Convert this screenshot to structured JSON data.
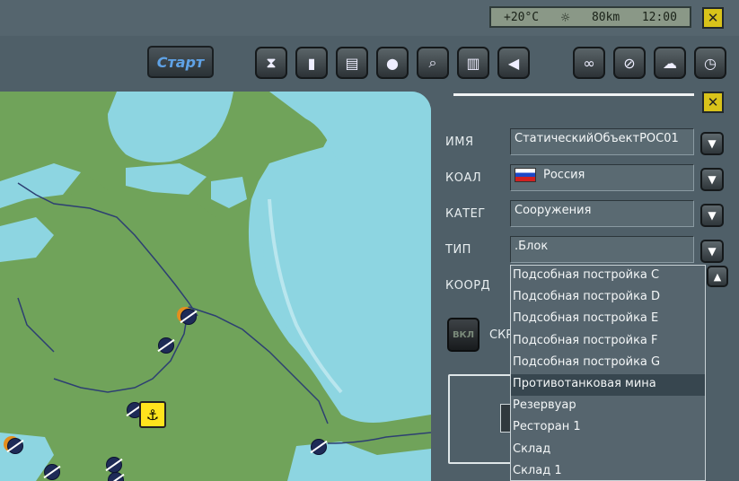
{
  "status": {
    "temperature": "+20°C",
    "weather_icon": "sun-icon",
    "visibility": "80km",
    "time": "12:00"
  },
  "close_label": "✕",
  "toolbar": {
    "start_label": "Старт",
    "tools": [
      "hourglass-icon",
      "clipboard-icon",
      "document-icon",
      "head-icon",
      "magnifier-doc-icon",
      "book-icon",
      "speaker-icon"
    ],
    "right_tools": [
      "binoculars-icon",
      "forbidden-icon",
      "weather-icon",
      "clock-icon"
    ]
  },
  "panel": {
    "name_label": "ИМЯ",
    "name_value": "СтатическийОбъектРОС01",
    "coal_label": "КОАЛ",
    "coal_value": "Россия",
    "categ_label": "КАТЕГ",
    "categ_value": "Сооружения",
    "type_label": "ТИП",
    "type_value": ".Блок",
    "coord_label": "КООРД",
    "on_button": "ВКЛ",
    "hide_label": "СКР"
  },
  "type_list": {
    "items": [
      "Подсобная постройка C",
      "Подсобная постройка D",
      "Подсобная постройка E",
      "Подсобная постройка F",
      "Подсобная постройка G",
      "Противотанковая мина",
      "Резервуар",
      "Ресторан 1",
      "Склад",
      "Склад 1"
    ],
    "selected_index": 5
  },
  "colors": {
    "water": "#8dd5e1",
    "land": "#70a35a",
    "accent": "#d9c31a",
    "panel": "#4f5f68"
  }
}
